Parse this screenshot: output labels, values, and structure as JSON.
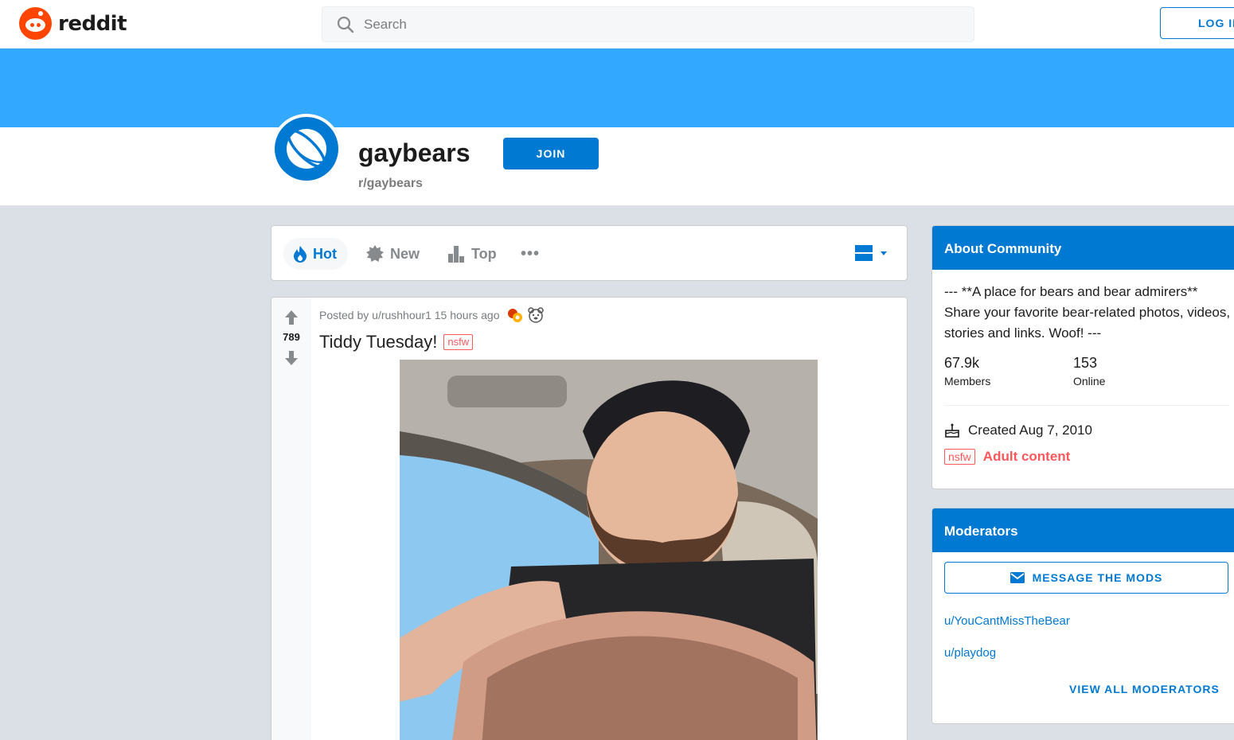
{
  "header": {
    "logo_text": "reddit",
    "search_placeholder": "Search",
    "login_label": "LOG IN"
  },
  "subreddit": {
    "title": "gaybears",
    "name": "r/gaybears",
    "join_label": "JOIN"
  },
  "sort": {
    "hot": "Hot",
    "new": "New",
    "top": "Top",
    "more": "•••"
  },
  "post": {
    "meta": "Posted by u/rushhour1 15 hours ago",
    "votes": "789",
    "title": "Tiddy Tuesday!",
    "tag": "nsfw"
  },
  "about": {
    "heading": "About Community",
    "description": "--- **A place for bears and bear admirers** Share your favorite bear-related photos, videos, stories and links. Woof! ---",
    "members_value": "67.9k",
    "members_label": "Members",
    "online_value": "153",
    "online_label": "Online",
    "created": "Created Aug 7, 2010",
    "nsfw_tag": "nsfw",
    "adult_label": "Adult content"
  },
  "moderators": {
    "heading": "Moderators",
    "message_label": "MESSAGE THE MODS",
    "mods": [
      "u/YouCantMissTheBear",
      "u/playdog"
    ],
    "view_all_label": "VIEW ALL MODERATORS"
  },
  "colors": {
    "brand": "#ff4500",
    "accent": "#0079d3",
    "banner": "#33a8ff",
    "nsfw": "#ff585b"
  }
}
